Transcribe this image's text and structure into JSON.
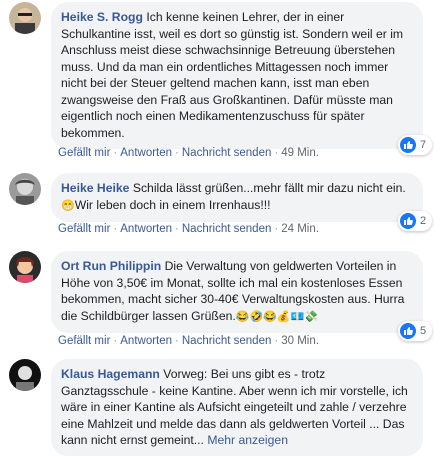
{
  "ui": {
    "actions": {
      "like": "Gefällt mir",
      "reply": "Antworten",
      "message": "Nachricht senden",
      "sep": "·"
    }
  },
  "comments": [
    {
      "author": "Heike S. Rogg",
      "text": "Ich kenne keinen Lehrer, der in einer Schulkantine isst, weil es dort so günstig ist. Sondern weil er im Anschluss meist diese schwachsinnige Betreuung überstehen muss. Und da man ein ordentliches Mittagessen noch immer nicht bei der Steuer geltend machen kann, isst man eben zwangsweise den Fraß aus Großkantinen. Dafür müsste man eigentlich noch einen Medikamentenzuschuss für später bekommen.",
      "time": "49 Min.",
      "reactions": "7"
    },
    {
      "author": "Heike Heike",
      "text": "Schilda lässt grüßen...mehr fällt mir dazu nicht ein.",
      "text2": "Wir leben doch in einem Irrenhaus!!!",
      "emoji": "😁",
      "time": "24 Min.",
      "reactions": "2"
    },
    {
      "author": "Ort Run Philippin",
      "text": "Die Verwaltung von geldwerten Vorteilen in Höhe von 3,50€ im Monat, sollte ich mal ein kostenloses Essen bekommen, macht sicher 30-40€ Verwaltungskosten aus. Hurra die Schildbürger lassen Grüßen.",
      "emoji": "😂🤣😂💰💶💸",
      "time": "30 Min.",
      "reactions": "5"
    },
    {
      "author": "Klaus Hagemann",
      "text": "Vorweg: Bei uns gibt es - trotz Ganztagsschule - keine Kantine. Aber wenn ich mir vorstelle, ich wäre in einer Kantine als Aufsicht eingeteilt und zahle / verzehre eine Mahlzeit und melde das dann als geldwerten Vorteil ... Das kann nicht ernst gemeint...",
      "more": "Mehr anzeigen"
    }
  ],
  "colors": {
    "link": "#385898",
    "bubble": "#f2f3f5",
    "like": "#1877f2"
  }
}
